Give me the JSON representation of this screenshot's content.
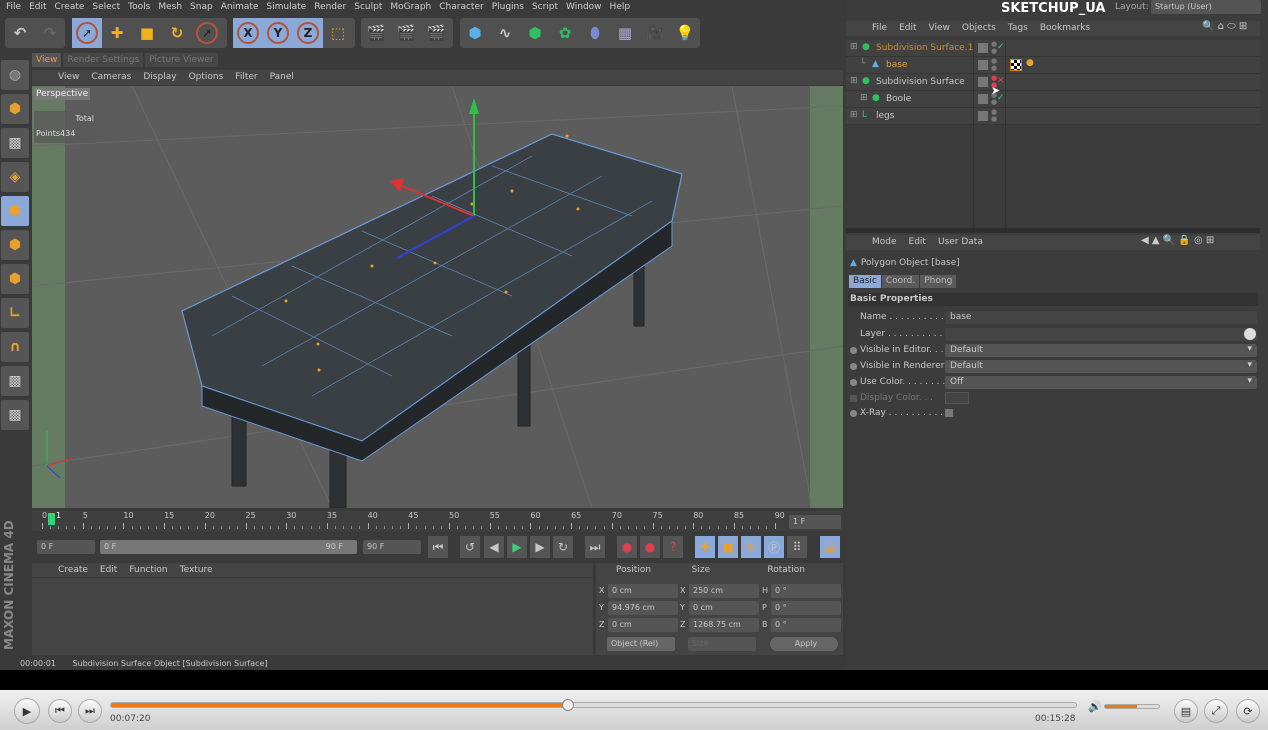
{
  "menubar": [
    "File",
    "Edit",
    "Create",
    "Select",
    "Tools",
    "Mesh",
    "Snap",
    "Animate",
    "Simulate",
    "Render",
    "Sculpt",
    "MoGraph",
    "Character",
    "Plugins",
    "Script",
    "Window",
    "Help"
  ],
  "brand": "SKETCHUP_UA",
  "layout": {
    "label": "Layout:",
    "value": "Startup (User)"
  },
  "viewport": {
    "tabs": [
      "View",
      "Render Settings",
      "Picture Viewer"
    ],
    "menu": [
      "View",
      "Cameras",
      "Display",
      "Options",
      "Filter",
      "Panel"
    ],
    "camera": "Perspective",
    "hud": {
      "total": "Total",
      "points_label": "Points",
      "points": "434"
    }
  },
  "timeline": {
    "ticks": [
      "0",
      "5",
      "10",
      "15",
      "20",
      "25",
      "30",
      "35",
      "40",
      "45",
      "50",
      "55",
      "60",
      "65",
      "70",
      "75",
      "80",
      "85",
      "90"
    ],
    "current": "1",
    "frame_field": "1 F",
    "start": "0 F",
    "range_start": "0 F",
    "range_end": "90 F",
    "end": "90 F"
  },
  "material": {
    "menu": [
      "Create",
      "Edit",
      "Function",
      "Texture"
    ]
  },
  "coords": {
    "headers": [
      "Position",
      "Size",
      "Rotation"
    ],
    "rows": [
      {
        "a": "X",
        "p": "0 cm",
        "b": "X",
        "s": "250 cm",
        "c": "H",
        "r": "0 °"
      },
      {
        "a": "Y",
        "p": "94.976 cm",
        "b": "Y",
        "s": "0 cm",
        "c": "P",
        "r": "0 °"
      },
      {
        "a": "Z",
        "p": "0 cm",
        "b": "Z",
        "s": "1268.75 cm",
        "c": "B",
        "r": "0 °"
      }
    ],
    "mode": "Object (Rel)",
    "size_mode": "Size",
    "apply": "Apply"
  },
  "status": {
    "time": "00:00:01",
    "text": "Subdivision Surface Object [Subdivision Surface]"
  },
  "objects": {
    "menu": [
      "File",
      "Edit",
      "View",
      "Objects",
      "Tags",
      "Bookmarks"
    ],
    "items": [
      {
        "name": "Subdivision Surface.1",
        "color": "#c8902a",
        "indent": 0
      },
      {
        "name": "base",
        "color": "#e0a030",
        "indent": 1
      },
      {
        "name": "Subdivision Surface",
        "color": "#c8c8c8",
        "indent": 0
      },
      {
        "name": "Boole",
        "color": "#c8c8c8",
        "indent": 1
      },
      {
        "name": "legs",
        "color": "#c8c8c8",
        "indent": 0
      }
    ]
  },
  "attributes": {
    "menu": [
      "Mode",
      "Edit",
      "User Data"
    ],
    "object": "Polygon Object [base]",
    "tabs": [
      "Basic",
      "Coord.",
      "Phong"
    ],
    "section": "Basic Properties",
    "props": [
      {
        "label": "Name . . . . . . . . . . .",
        "value": "base"
      },
      {
        "label": "Layer . . . . . . . . . . . .",
        "value": ""
      },
      {
        "label": "Visible in Editor. . .",
        "value": "Default"
      },
      {
        "label": "Visible in Renderer",
        "value": "Default"
      },
      {
        "label": "Use Color. . . . . . . .",
        "value": "Off"
      },
      {
        "label": "Display Color. . .",
        "value": ""
      },
      {
        "label": "X-Ray . . . . . . . . . .",
        "value": ""
      }
    ]
  },
  "player": {
    "elapsed": "00:07:20",
    "total": "00:15:28",
    "progress": 0.474,
    "volume": 0.6,
    "accent": "#f07a10"
  },
  "side_logo": "MAXON CINEMA 4D"
}
